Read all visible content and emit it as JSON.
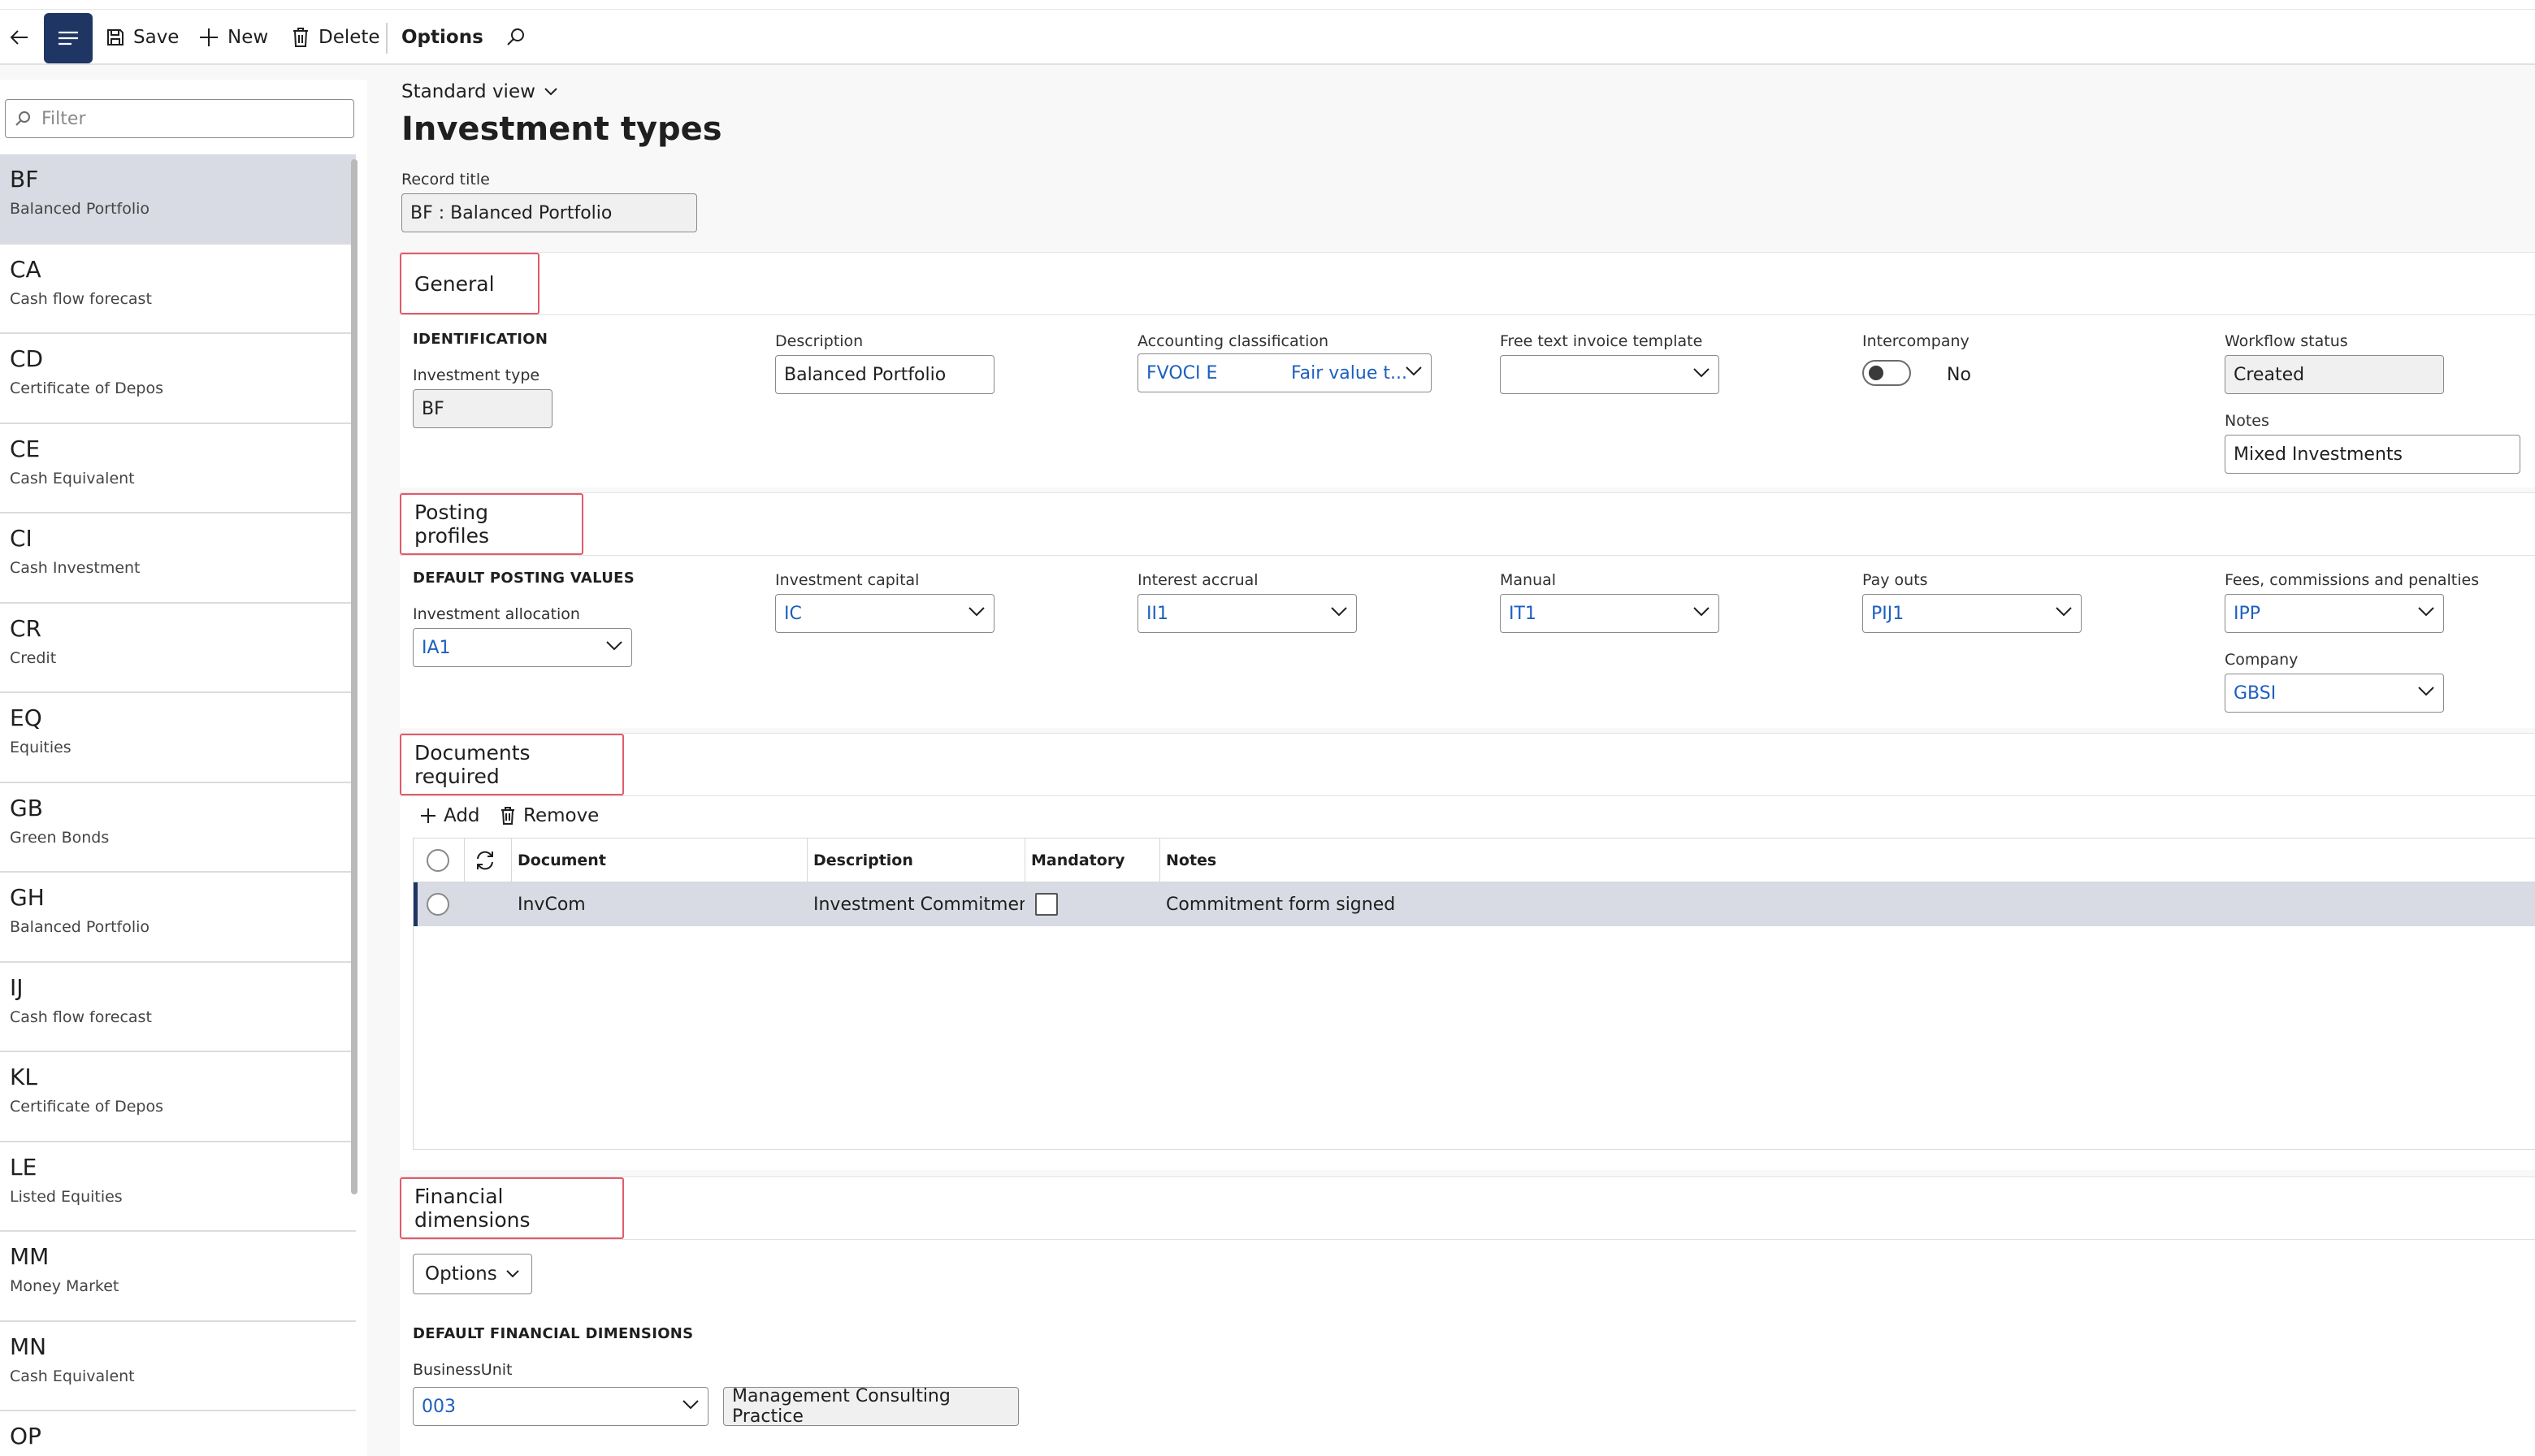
{
  "toolbar": {
    "save_label": "Save",
    "new_label": "New",
    "delete_label": "Delete",
    "options_label": "Options"
  },
  "filter": {
    "placeholder": "Filter"
  },
  "list": {
    "items": [
      {
        "code": "BF",
        "name": "Balanced Portfolio"
      },
      {
        "code": "CA",
        "name": "Cash flow forecast"
      },
      {
        "code": "CD",
        "name": "Certificate of Depos"
      },
      {
        "code": "CE",
        "name": "Cash Equivalent"
      },
      {
        "code": "CI",
        "name": "Cash Investment"
      },
      {
        "code": "CR",
        "name": "Credit"
      },
      {
        "code": "EQ",
        "name": "Equities"
      },
      {
        "code": "GB",
        "name": "Green Bonds"
      },
      {
        "code": "GH",
        "name": "Balanced Portfolio"
      },
      {
        "code": "IJ",
        "name": "Cash flow forecast"
      },
      {
        "code": "KL",
        "name": "Certificate of Depos"
      },
      {
        "code": "LE",
        "name": "Listed Equities"
      },
      {
        "code": "MM",
        "name": "Money Market"
      },
      {
        "code": "MN",
        "name": "Cash Equivalent"
      },
      {
        "code": "OP",
        "name": ""
      }
    ]
  },
  "page": {
    "view": "Standard view",
    "title": "Investment types",
    "record_title_label": "Record title",
    "record_title_value": "BF : Balanced Portfolio"
  },
  "general": {
    "heading": "General",
    "identification": "IDENTIFICATION",
    "investment_type_label": "Investment type",
    "investment_type_value": "BF",
    "description_label": "Description",
    "description_value": "Balanced Portfolio",
    "accounting_label": "Accounting classification",
    "accounting_code": "FVOCI E",
    "accounting_desc": "Fair value t...",
    "free_text_label": "Free text invoice template",
    "free_text_value": "",
    "intercompany_label": "Intercompany",
    "intercompany_value": "No",
    "workflow_label": "Workflow status",
    "workflow_value": "Created",
    "notes_label": "Notes",
    "notes_value": "Mixed Investments"
  },
  "posting": {
    "heading": "Posting profiles",
    "defaults": "DEFAULT POSTING VALUES",
    "alloc_label": "Investment allocation",
    "alloc_value": "IA1",
    "capital_label": "Investment capital",
    "capital_value": "IC",
    "accrual_label": "Interest accrual",
    "accrual_value": "II1",
    "manual_label": "Manual",
    "manual_value": "IT1",
    "payouts_label": "Pay outs",
    "payouts_value": "PIJ1",
    "fees_label": "Fees, commissions and penalties",
    "fees_value": "IPP",
    "company_label": "Company",
    "company_value": "GBSI"
  },
  "documents": {
    "heading": "Documents required",
    "add_label": "Add",
    "remove_label": "Remove",
    "columns": [
      "Document",
      "Description",
      "Mandatory",
      "Notes"
    ],
    "rows": [
      {
        "document": "InvCom",
        "description": "Investment Commitmen",
        "notes": "Commitment form signed"
      }
    ]
  },
  "financial": {
    "heading": "Financial dimensions",
    "options_label": "Options",
    "defaults": "DEFAULT FINANCIAL DIMENSIONS",
    "bu_label": "BusinessUnit",
    "bu_value": "003",
    "bu_desc": "Management Consulting Practice"
  },
  "colors": {
    "accent": "#1f3665",
    "section_outline": "#e25b6b",
    "link": "#1d5fbf",
    "selected_row": "#d8dbe3"
  }
}
